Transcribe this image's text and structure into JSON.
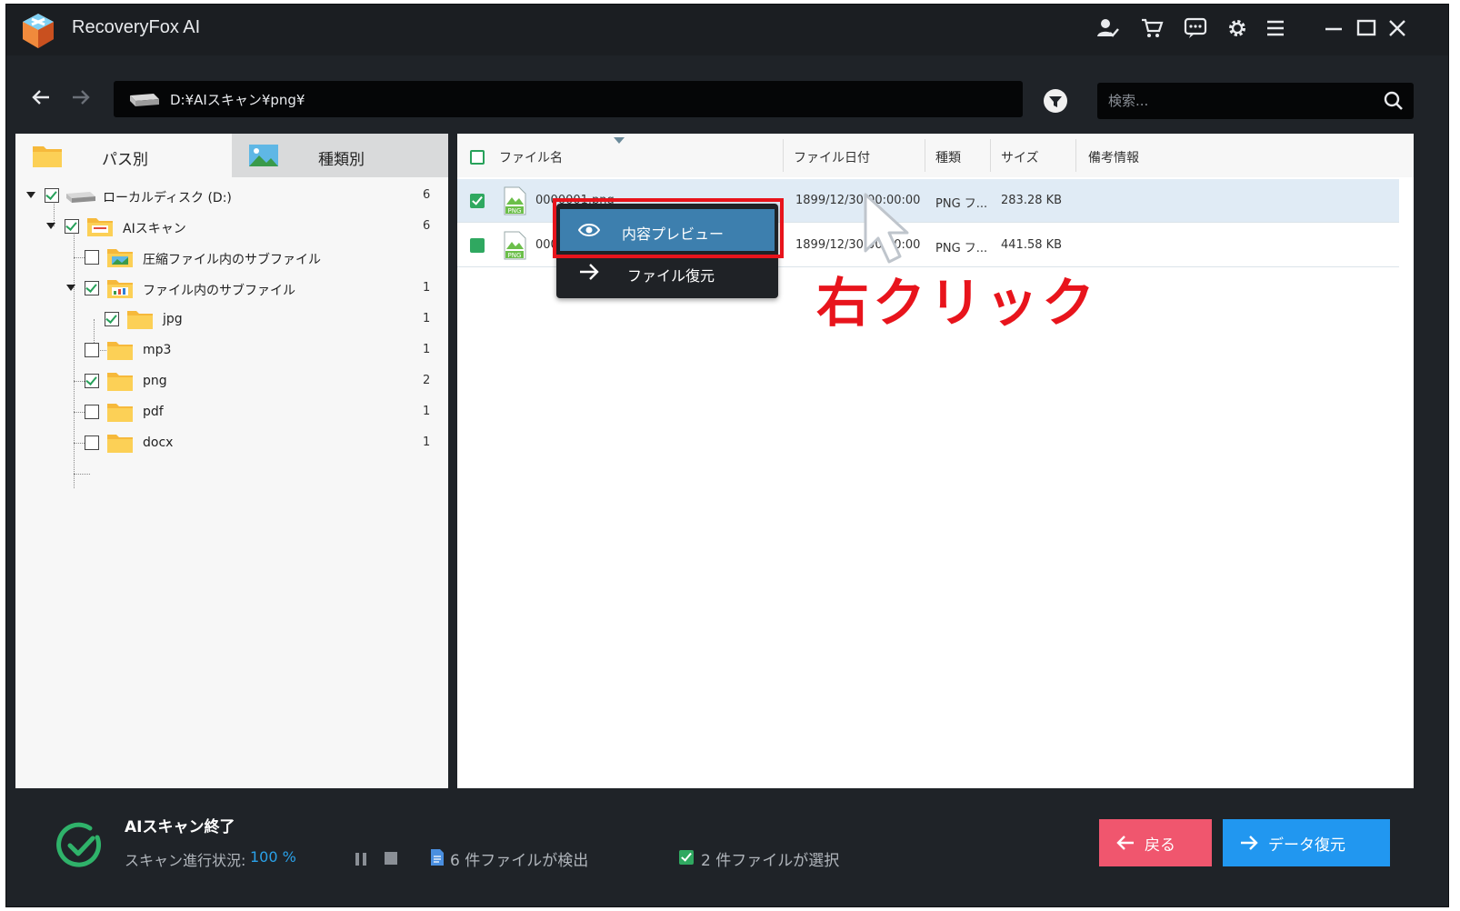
{
  "app": {
    "title": "RecoveryFox AI"
  },
  "address": {
    "path": "D:¥AIスキャン¥png¥",
    "search_placeholder": "検索..."
  },
  "tabs": [
    {
      "label": "パス別"
    },
    {
      "label": "種類別"
    }
  ],
  "tree": [
    {
      "label": "ローカルディスク (D:)",
      "count": "6",
      "checked": true
    },
    {
      "label": "AIスキャン",
      "count": "6",
      "checked": true
    },
    {
      "label": "圧縮ファイル内のサブファイル",
      "count": "",
      "checked": false
    },
    {
      "label": "ファイル内のサブファイル",
      "count": "1",
      "checked": true
    },
    {
      "label": "jpg",
      "count": "1",
      "checked": true
    },
    {
      "label": "mp3",
      "count": "1",
      "checked": false
    },
    {
      "label": "png",
      "count": "2",
      "checked": true
    },
    {
      "label": "pdf",
      "count": "1",
      "checked": false
    },
    {
      "label": "docx",
      "count": "1",
      "checked": false
    }
  ],
  "table": {
    "columns": [
      "ファイル名",
      "ファイル日付",
      "種類",
      "サイズ",
      "備考情報"
    ],
    "rows": [
      {
        "name": "0000001.png",
        "date": "1899/12/30 00:00:00",
        "type": "PNG フ...",
        "size": "283.28 KB",
        "note": ""
      },
      {
        "name": "000",
        "date": "1899/12/30 00:00:00",
        "type": "PNG フ...",
        "size": "441.58 KB",
        "note": ""
      }
    ]
  },
  "context_menu": {
    "items": [
      {
        "label": "内容プレビュー"
      },
      {
        "label": "ファイル復元"
      }
    ]
  },
  "annotation": {
    "text": "右クリック",
    "color": "#e8141c"
  },
  "status": {
    "title": "AIスキャン終了",
    "progress_label": "スキャン進行状況:",
    "progress_value": "100 %",
    "found": "6 件ファイルが検出",
    "selected": "2 件ファイルが選択"
  },
  "buttons": {
    "back": "戻る",
    "recover": "データ復元"
  },
  "colors": {
    "accent": "#2197f0",
    "back": "#f0566e",
    "check": "#2fa860",
    "highlight": "#3d7fae"
  }
}
